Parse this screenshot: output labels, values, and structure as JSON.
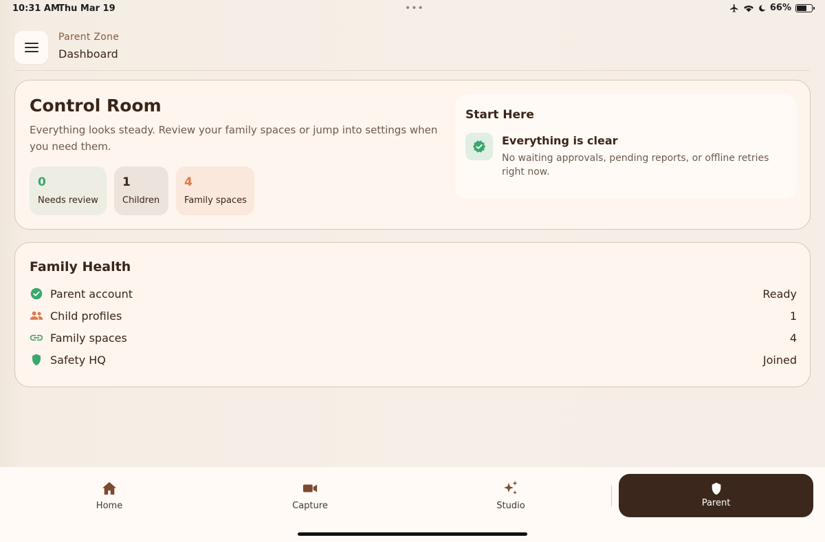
{
  "status_bar": {
    "time": "10:31 AM",
    "date": "Thu Mar 19",
    "battery_percent": "66%",
    "battery_level": 0.66
  },
  "header": {
    "eyebrow": "Parent Zone",
    "title": "Dashboard"
  },
  "control_room": {
    "title": "Control Room",
    "description": "Everything looks steady. Review your family spaces or jump into settings when you need them.",
    "stats": [
      {
        "value": "0",
        "label": "Needs review"
      },
      {
        "value": "1",
        "label": "Children"
      },
      {
        "value": "4",
        "label": "Family spaces"
      }
    ],
    "start_here": {
      "title": "Start Here",
      "heading": "Everything is clear",
      "body": "No waiting approvals, pending reports, or offline retries right now."
    }
  },
  "family_health": {
    "title": "Family Health",
    "rows": [
      {
        "label": "Parent account",
        "value": "Ready",
        "icon": "check-circle-icon"
      },
      {
        "label": "Child profiles",
        "value": "1",
        "icon": "people-icon"
      },
      {
        "label": "Family spaces",
        "value": "4",
        "icon": "link-icon"
      },
      {
        "label": "Safety HQ",
        "value": "Joined",
        "icon": "shield-icon"
      }
    ]
  },
  "nav": {
    "home": "Home",
    "capture": "Capture",
    "studio": "Studio",
    "parent": "Parent"
  },
  "colors": {
    "accent_dark": "#3b271b",
    "success": "#3aa86a",
    "warm": "#e07848"
  }
}
